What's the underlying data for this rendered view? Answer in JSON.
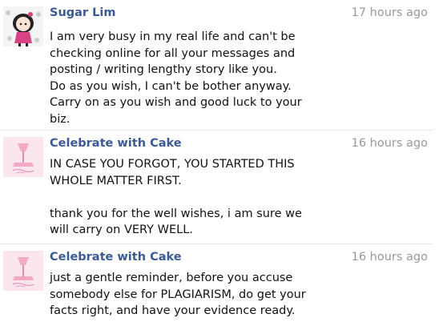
{
  "messages": [
    {
      "author": "Sugar Lim",
      "time": "17 hours ago",
      "avatar": "cartoon-girl-avatar",
      "lines": [
        "I am very busy in my real life and can't be",
        "checking online for all your messages and",
        "posting / writing lengthy story like you.",
        "Do as you wish, I can't be bother anyway.",
        "Carry on as you wish and good luck to your",
        "biz."
      ]
    },
    {
      "author": "Celebrate with Cake",
      "time": "16 hours ago",
      "avatar": "pink-cake-logo",
      "lines": [
        "IN CASE YOU FORGOT, YOU STARTED THIS",
        "WHOLE MATTER FIRST.",
        "",
        "thank you for the well wishes, i am sure we",
        "will carry on VERY WELL."
      ]
    },
    {
      "author": "Celebrate with Cake",
      "time": "16 hours ago",
      "avatar": "pink-cake-logo",
      "lines": [
        "just a gentle reminder, before you accuse",
        "somebody else for PLAGIARISM, do get your",
        "facts right, and have your evidence ready."
      ]
    }
  ],
  "colors": {
    "author_link": "#3b5998",
    "timestamp": "#999999",
    "text": "#111111",
    "separator": "#e5e5e5"
  }
}
